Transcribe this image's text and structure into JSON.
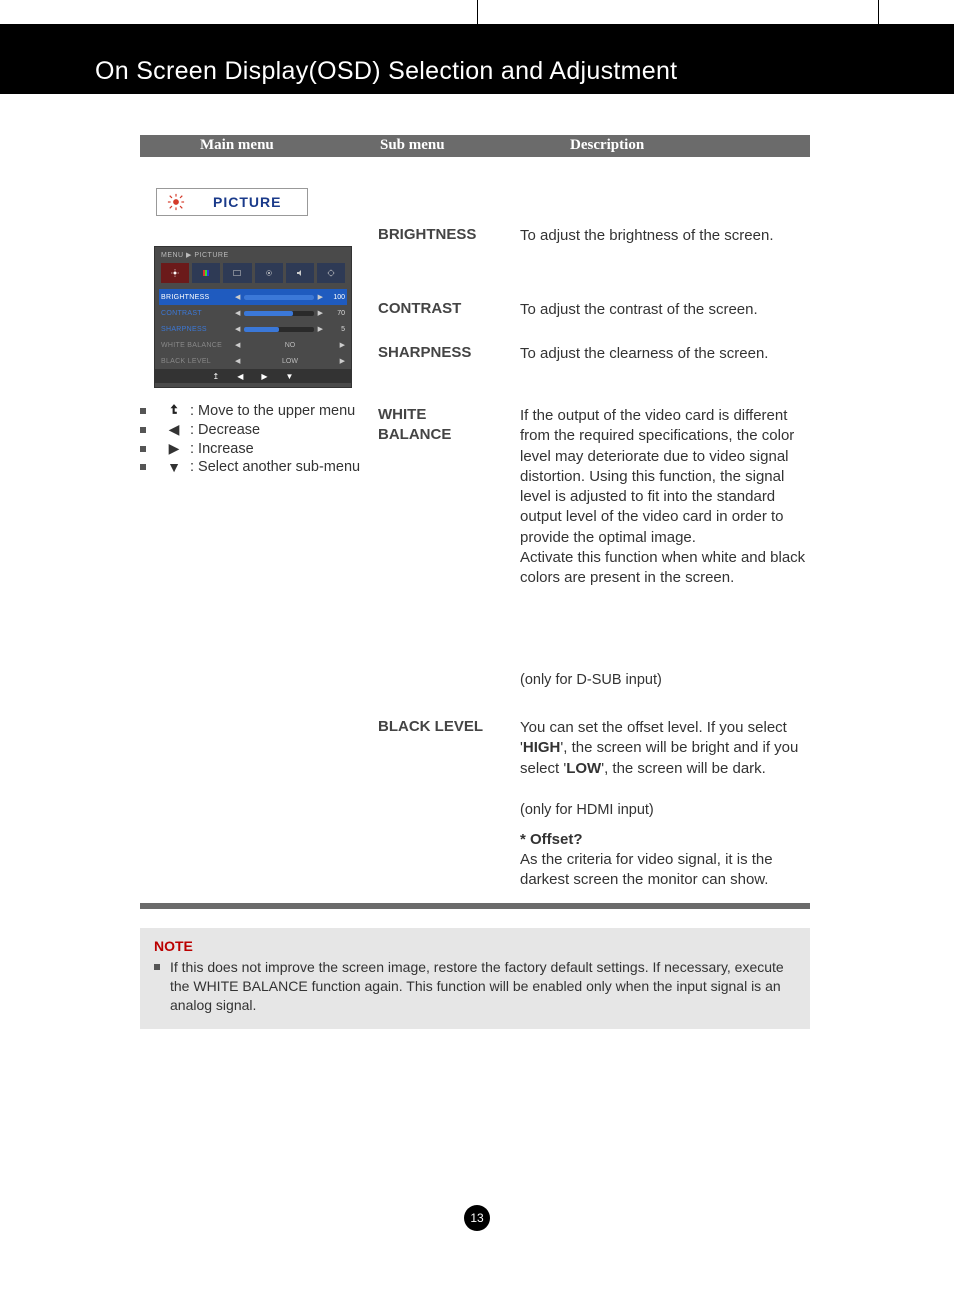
{
  "page_title": "On Screen Display(OSD) Selection and Adjustment",
  "header": {
    "col1": "Main menu",
    "col2": "Sub menu",
    "col3": "Description"
  },
  "picture_label": "PICTURE",
  "osd": {
    "breadcrumb": "MENU ▶ PICTURE",
    "rows": [
      {
        "label": "BRIGHTNESS",
        "value": "100",
        "fill": 100,
        "highlight": true
      },
      {
        "label": "CONTRAST",
        "value": "70",
        "fill": 70
      },
      {
        "label": "SHARPNESS",
        "value": "5",
        "fill": 50
      },
      {
        "label": "WHITE BALANCE",
        "opt": "NO",
        "dim": true
      },
      {
        "label": "BLACK LEVEL",
        "opt": "LOW",
        "dim": true
      }
    ]
  },
  "nav_legend": [
    {
      "icon": "up-return",
      "label": ": Move to the upper menu"
    },
    {
      "icon": "left",
      "label": ": Decrease"
    },
    {
      "icon": "right",
      "label": ": Increase"
    },
    {
      "icon": "down",
      "label": ": Select another sub-menu"
    }
  ],
  "submenus": {
    "brightness": "BRIGHTNESS",
    "contrast": "CONTRAST",
    "sharpness": "SHARPNESS",
    "white_balance_1": "WHITE",
    "white_balance_2": "BALANCE",
    "black_level": "BLACK LEVEL"
  },
  "descriptions": {
    "brightness": "To adjust the brightness of the screen.",
    "contrast": "To adjust the contrast of the screen.",
    "sharpness": "To adjust the clearness of the screen.",
    "white_balance": "If the output of the video card is different from the required specifications, the color level may deteriorate due to video signal distortion. Using this function, the signal level is adjusted to fit into the standard output level of the video card in order to provide the optimal image.\nActivate this function when white and black colors are present in the screen.",
    "white_balance_note": "(only for D-SUB input)",
    "black_level_p1": "You can set the offset level. If you select '",
    "black_level_high": "HIGH",
    "black_level_p2": "', the screen will be bright and if you select '",
    "black_level_low": "LOW",
    "black_level_p3": "', the screen will be dark.",
    "black_level_note": "(only for HDMI input)",
    "offset_title": "* Offset?",
    "offset_body": "As the criteria for video signal, it is the darkest screen the monitor can show."
  },
  "note": {
    "title": "NOTE",
    "body": "If this does not improve the screen image, restore the factory default settings. If necessary, execute the WHITE BALANCE function again. This function will be enabled only when the input signal is an analog signal."
  },
  "page_number": "13"
}
